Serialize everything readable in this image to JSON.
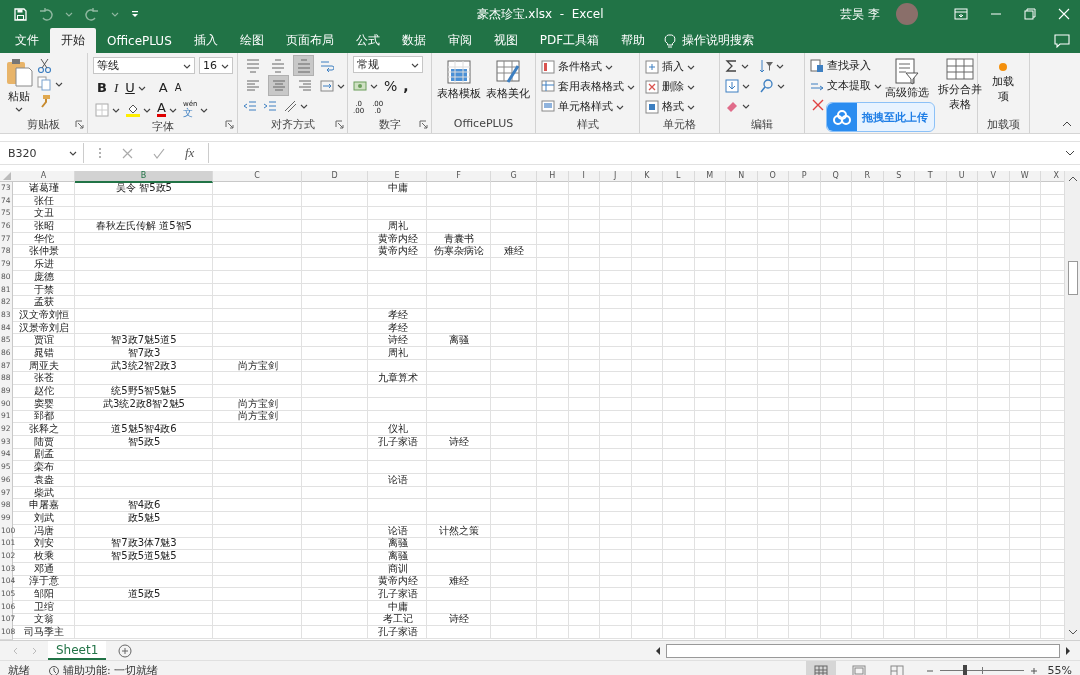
{
  "title_bar": {
    "title": "豪杰珍宝.xlsx  -  Excel",
    "user": "芸昊 李"
  },
  "tabs": [
    {
      "label": "文件",
      "selected": false
    },
    {
      "label": "开始",
      "selected": true
    },
    {
      "label": "OfficePLUS",
      "selected": false
    },
    {
      "label": "插入",
      "selected": false
    },
    {
      "label": "绘图",
      "selected": false
    },
    {
      "label": "页面布局",
      "selected": false
    },
    {
      "label": "公式",
      "selected": false
    },
    {
      "label": "数据",
      "selected": false
    },
    {
      "label": "审阅",
      "selected": false
    },
    {
      "label": "视图",
      "selected": false
    },
    {
      "label": "PDF工具箱",
      "selected": false
    },
    {
      "label": "帮助",
      "selected": false
    }
  ],
  "tell_me": "操作说明搜索",
  "ribbon": {
    "groups": [
      {
        "kind": "clipboard",
        "label": "剪贴板",
        "paste": "粘贴"
      },
      {
        "kind": "font",
        "label": "字体",
        "font": "等线",
        "size": "16",
        "styles": [
          "B",
          "I",
          "U"
        ],
        "grow": "A",
        "shrink": "A",
        "color_letter": "A",
        "phonetic": "wén",
        "phonetic_char": "文"
      },
      {
        "kind": "align",
        "label": "对齐方式"
      },
      {
        "kind": "number",
        "label": "数字",
        "format": "常规",
        "percent": "%",
        "comma": ",",
        "more_decimals": [
          ".0",
          ".00"
        ],
        "fewer_decimals": [
          ".00",
          ".0"
        ]
      },
      {
        "kind": "big",
        "label": "OfficePLUS",
        "buttons": [
          "表格模板",
          "表格美化"
        ]
      },
      {
        "kind": "list",
        "label": "样式",
        "items": [
          "条件格式",
          "套用表格格式",
          "单元格样式"
        ]
      },
      {
        "kind": "list",
        "label": "单元格",
        "items": [
          "插入",
          "删除",
          "格式"
        ]
      },
      {
        "kind": "editing",
        "label": "编辑"
      },
      {
        "kind": "tools",
        "items": [
          "查找录入",
          "文本提取"
        ],
        "big": [
          "高级筛选",
          "拆分合并表格"
        ]
      },
      {
        "kind": "addin",
        "label": "加载项",
        "button": "加载项"
      }
    ]
  },
  "upload_popup": {
    "text": "拖拽至此上传"
  },
  "formula_bar": {
    "name_box": "B320",
    "fx": "fx"
  },
  "columns": [
    {
      "label": "A",
      "selected": false
    },
    {
      "label": "B",
      "selected": true
    },
    {
      "label": "C",
      "selected": false
    },
    {
      "label": "D",
      "selected": false
    },
    {
      "label": "E",
      "selected": false
    },
    {
      "label": "F",
      "selected": false
    },
    {
      "label": "G",
      "selected": false
    },
    {
      "label": "H",
      "selected": false
    },
    {
      "label": "I",
      "selected": false
    },
    {
      "label": "J",
      "selected": false
    },
    {
      "label": "K",
      "selected": false
    },
    {
      "label": "L",
      "selected": false
    },
    {
      "label": "M",
      "selected": false
    },
    {
      "label": "N",
      "selected": false
    },
    {
      "label": "O",
      "selected": false
    },
    {
      "label": "P",
      "selected": false
    },
    {
      "label": "Q",
      "selected": false
    },
    {
      "label": "R",
      "selected": false
    },
    {
      "label": "S",
      "selected": false
    },
    {
      "label": "T",
      "selected": false
    },
    {
      "label": "U",
      "selected": false
    },
    {
      "label": "V",
      "selected": false
    },
    {
      "label": "W",
      "selected": false
    },
    {
      "label": "X",
      "selected": false
    }
  ],
  "rows": [
    {
      "number": "73",
      "cells": {
        "A": "诸葛瑾",
        "B": "吴令 智5政5",
        "E": "中庸"
      }
    },
    {
      "number": "74",
      "cells": {
        "A": "张任"
      }
    },
    {
      "number": "75",
      "cells": {
        "A": "文丑"
      }
    },
    {
      "number": "76",
      "cells": {
        "A": "张昭",
        "B": "春秋左氏传解 道5智5",
        "E": "周礼"
      }
    },
    {
      "number": "77",
      "cells": {
        "A": "华佗",
        "E": "黄帝内经",
        "F": "青囊书"
      }
    },
    {
      "number": "78",
      "cells": {
        "A": "张仲景",
        "E": "黄帝内经",
        "F": "伤寒杂病论",
        "G": "难经"
      }
    },
    {
      "number": "79",
      "cells": {
        "A": "乐进"
      }
    },
    {
      "number": "80",
      "cells": {
        "A": "庞德"
      }
    },
    {
      "number": "81",
      "cells": {
        "A": "于禁"
      }
    },
    {
      "number": "82",
      "cells": {
        "A": "孟获"
      }
    },
    {
      "number": "83",
      "cells": {
        "A": "汉文帝刘恒",
        "E": "孝经"
      }
    },
    {
      "number": "84",
      "cells": {
        "A": "汉景帝刘启",
        "E": "孝经"
      }
    },
    {
      "number": "85",
      "cells": {
        "A": "贾谊",
        "B": "智3政7魅5道5",
        "E": "诗经",
        "F": "离骚"
      }
    },
    {
      "number": "86",
      "cells": {
        "A": "晁错",
        "B": "智7政3",
        "E": "周礼"
      }
    },
    {
      "number": "87",
      "cells": {
        "A": "周亚夫",
        "B": "武3统2智2政3",
        "C": "尚方宝剑"
      }
    },
    {
      "number": "88",
      "cells": {
        "A": "张苍",
        "E": "九章算术"
      }
    },
    {
      "number": "89",
      "cells": {
        "A": "赵佗",
        "B": "统5野5智5魅5"
      }
    },
    {
      "number": "90",
      "cells": {
        "A": "窦婴",
        "B": "武3统2政8智2魅5",
        "C": "尚方宝剑"
      }
    },
    {
      "number": "91",
      "cells": {
        "A": "郅都",
        "C": "尚方宝剑"
      }
    },
    {
      "number": "92",
      "cells": {
        "A": "张释之",
        "B": "道5魅5智4政6",
        "E": "仪礼"
      }
    },
    {
      "number": "93",
      "cells": {
        "A": "陆贾",
        "B": "智5政5",
        "E": "孔子家语",
        "F": "诗经"
      }
    },
    {
      "number": "94",
      "cells": {
        "A": "剧孟"
      }
    },
    {
      "number": "95",
      "cells": {
        "A": "栾布"
      }
    },
    {
      "number": "96",
      "cells": {
        "A": "袁盎",
        "E": "论语"
      }
    },
    {
      "number": "97",
      "cells": {
        "A": "柴武"
      }
    },
    {
      "number": "98",
      "cells": {
        "A": "申屠嘉",
        "B": "智4政6"
      }
    },
    {
      "number": "99",
      "cells": {
        "A": "刘武",
        "B": "政5魅5"
      }
    },
    {
      "number": "100",
      "cells": {
        "A": "冯唐",
        "E": "论语",
        "F": "计然之策"
      }
    },
    {
      "number": "101",
      "cells": {
        "A": "刘安",
        "B": "智7政3体7魅3",
        "E": "离骚"
      }
    },
    {
      "number": "102",
      "cells": {
        "A": "枚乘",
        "B": "智5政5道5魅5",
        "E": "离骚"
      }
    },
    {
      "number": "103",
      "cells": {
        "A": "邓通",
        "E": "商训"
      }
    },
    {
      "number": "104",
      "cells": {
        "A": "淳于意",
        "E": "黄帝内经",
        "F": "难经"
      }
    },
    {
      "number": "105",
      "cells": {
        "A": "邹阳",
        "B": "道5政5",
        "E": "孔子家语"
      }
    },
    {
      "number": "106",
      "cells": {
        "A": "卫绾",
        "E": "中庸"
      }
    },
    {
      "number": "107",
      "cells": {
        "A": "文翁",
        "E": "考工记",
        "F": "诗经"
      }
    },
    {
      "number": "108",
      "cells": {
        "A": "司马季主",
        "E": "孔子家语"
      }
    }
  ],
  "sheets": [
    {
      "label": "Sheet1",
      "selected": true
    }
  ],
  "status_bar": {
    "status": "就绪",
    "accessibility": "辅助功能: 一切就绪",
    "views": [
      {
        "kind": "normal",
        "selected": true
      },
      {
        "kind": "page_layout",
        "selected": false
      },
      {
        "kind": "page_break",
        "selected": false
      }
    ],
    "zoom_slider": {
      "level": 0.3
    },
    "zoom": "55%"
  }
}
